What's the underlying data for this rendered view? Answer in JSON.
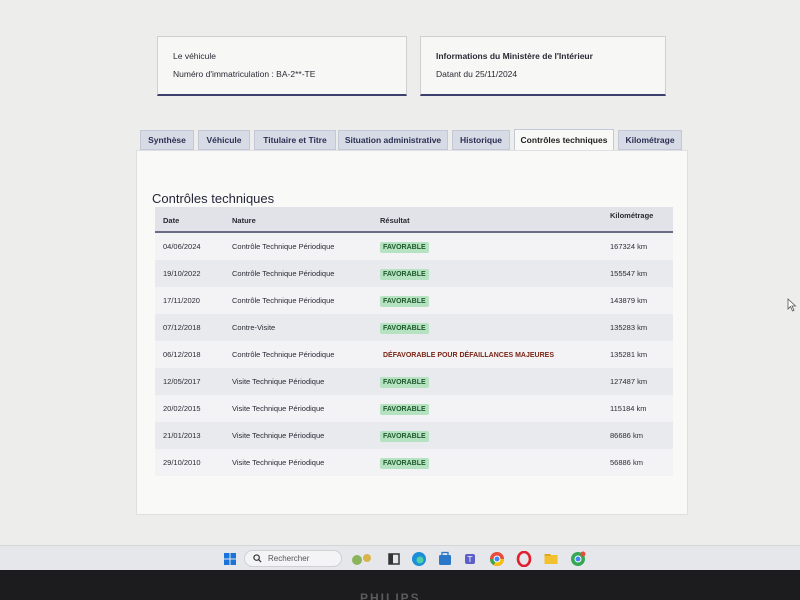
{
  "vehicle_card": {
    "heading": "Le véhicule",
    "plate": "Numéro d'immatriculation : BA-2**-TE"
  },
  "ministry_card": {
    "heading": "Informations du Ministère de l'Intérieur",
    "date": "Datant du 25/11/2024"
  },
  "tabs": [
    {
      "label": "Synthèse"
    },
    {
      "label": "Véhicule"
    },
    {
      "label": "Titulaire et Titre"
    },
    {
      "label": "Situation administrative"
    },
    {
      "label": "Historique"
    },
    {
      "label": "Contrôles techniques"
    },
    {
      "label": "Kilométrage"
    }
  ],
  "active_tab": "Contrôles techniques",
  "panel": {
    "title": "Contrôles techniques",
    "columns": {
      "date": "Date",
      "nature": "Nature",
      "result": "Résultat",
      "km": "Kilométrage"
    },
    "rows": [
      {
        "date": "04/06/2024",
        "nature": "Contrôle Technique Périodique",
        "result": "FAVORABLE",
        "km": "167324 km"
      },
      {
        "date": "19/10/2022",
        "nature": "Contrôle Technique Périodique",
        "result": "FAVORABLE",
        "km": "155547 km"
      },
      {
        "date": "17/11/2020",
        "nature": "Contrôle Technique Périodique",
        "result": "FAVORABLE",
        "km": "143879 km"
      },
      {
        "date": "07/12/2018",
        "nature": "Contre-Visite",
        "result": "FAVORABLE",
        "km": "135283 km"
      },
      {
        "date": "06/12/2018",
        "nature": "Contrôle Technique Périodique",
        "result": "DÉFAVORABLE POUR DÉFAILLANCES MAJEURES",
        "km": "135281 km"
      },
      {
        "date": "12/05/2017",
        "nature": "Visite Technique Périodique",
        "result": "FAVORABLE",
        "km": "127487 km"
      },
      {
        "date": "20/02/2015",
        "nature": "Visite Technique Périodique",
        "result": "FAVORABLE",
        "km": "115184 km"
      },
      {
        "date": "21/01/2013",
        "nature": "Visite Technique Périodique",
        "result": "FAVORABLE",
        "km": "86686 km"
      },
      {
        "date": "29/10/2010",
        "nature": "Visite Technique Périodique",
        "result": "FAVORABLE",
        "km": "56886 km"
      }
    ]
  },
  "taskbar": {
    "search_placeholder": "Rechercher"
  },
  "monitor_brand": "PHILIPS",
  "colors": {
    "favorable_bg": "#b5e2c0",
    "favorable_text": "#1f5a2c",
    "defavorable_text": "#7a2414",
    "accent": "#3d3f6e"
  }
}
